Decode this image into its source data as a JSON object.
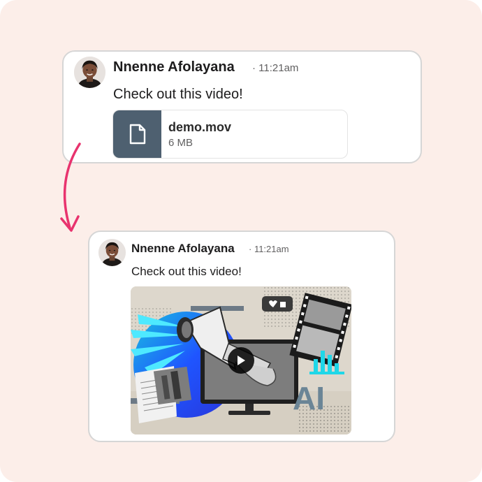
{
  "colors": {
    "background": "#fceee9",
    "arrow": "#e8336e",
    "file_thumb": "#4e6070"
  },
  "message_before": {
    "author": "Nnenne Afolayana",
    "time": "· 11:21am",
    "text": "Check out this video!",
    "attachment": {
      "icon": "document-icon",
      "name": "demo.mov",
      "size": "6 MB"
    }
  },
  "message_after": {
    "author": "Nnenne Afolayana",
    "time": "· 11:21am",
    "text": "Check out this video!",
    "video": {
      "play_icon": "play-icon",
      "logo_text": "AI"
    }
  }
}
